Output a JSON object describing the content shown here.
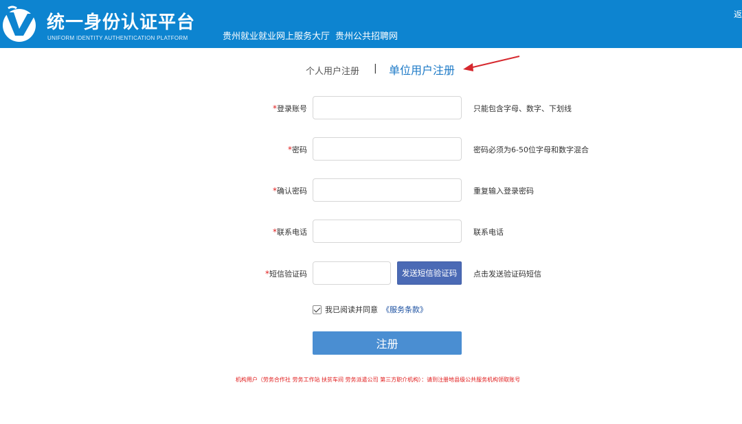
{
  "header": {
    "logo_title": "统一身份认证平台",
    "logo_subtitle": "UNIFORM IDENTITY AUTHENTICATION PLATFORM",
    "links": [
      "贵州就业就业网上服务大厅",
      "贵州公共招聘网"
    ],
    "back_label": "返回"
  },
  "tabs": {
    "personal": "个人用户注册",
    "separator": "|",
    "company": "单位用户注册"
  },
  "form": {
    "required_mark": "*",
    "fields": [
      {
        "label": "登录账号",
        "value": "",
        "hint": "只能包含字母、数字、下划线"
      },
      {
        "label": "密码",
        "value": "",
        "hint": "密码必须为6-50位字母和数字混合"
      },
      {
        "label": "确认密码",
        "value": "",
        "hint": "重复输入登录密码"
      },
      {
        "label": "联系电话",
        "value": "",
        "hint": "联系电话"
      },
      {
        "label": "短信验证码",
        "value": "",
        "hint": "点击发送验证码短信"
      }
    ],
    "sms_button": "发送短信验证码",
    "agree_text": "我已阅读并同意",
    "terms_link": "《服务条款》",
    "submit": "注册"
  },
  "notice": "机构用户（劳务合作社 劳务工作站 扶贫车间 劳务派遣公司 第三方职介机构）：请到注册地县级公共服务机构领取账号",
  "colors": {
    "header_bg": "#0d84d0",
    "accent": "#1d7ac7",
    "submit_bg": "#4a8ed2",
    "sms_button_bg": "#4b6ab5",
    "required": "#e02020",
    "arrow": "#d6282e"
  }
}
